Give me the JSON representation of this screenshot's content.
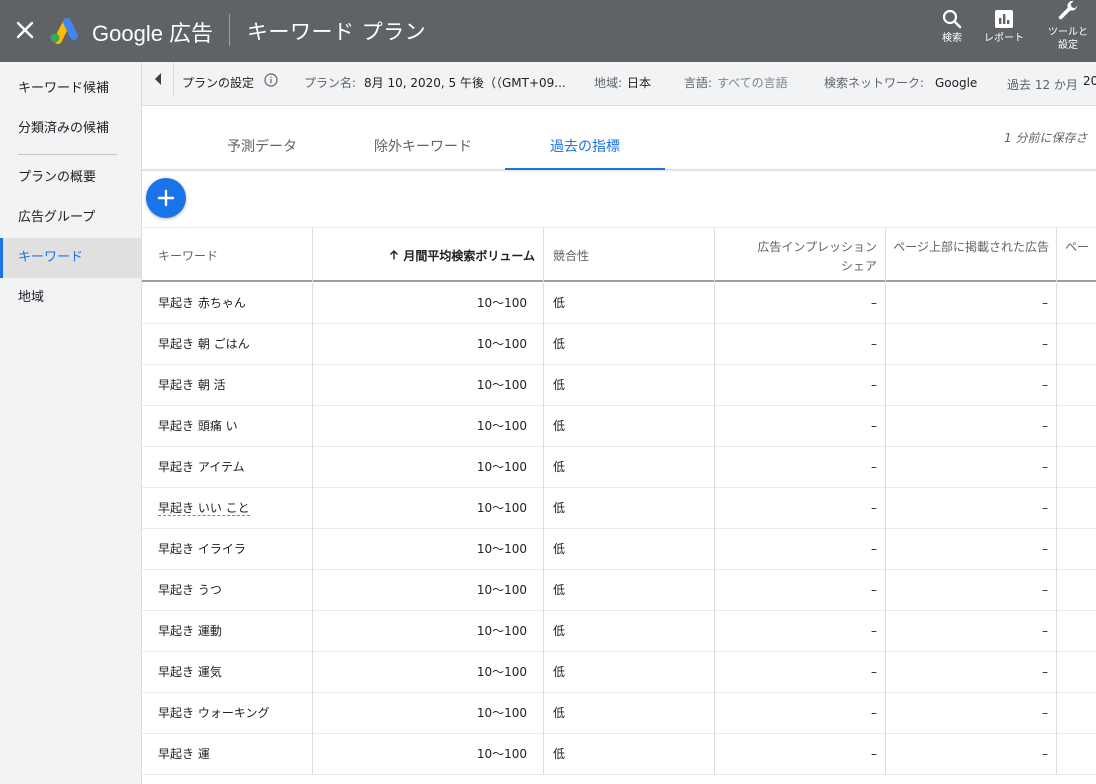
{
  "header": {
    "brand": "Google 広告",
    "page_title": "キーワード プラン",
    "actions": [
      {
        "label": "検索",
        "icon": "search-icon"
      },
      {
        "label": "レポート",
        "icon": "report-icon"
      },
      {
        "label_line1": "ツールと",
        "label_line2": "設定",
        "icon": "wrench-icon"
      }
    ]
  },
  "sidebar": {
    "items": [
      {
        "label": "キーワード候補"
      },
      {
        "label": "分類済みの候補"
      },
      {
        "label": "プランの概要"
      },
      {
        "label": "広告グループ"
      },
      {
        "label": "キーワード",
        "active": true
      },
      {
        "label": "地域"
      }
    ]
  },
  "settings": {
    "title": "プランの設定",
    "plan_name_label": "プラン名:",
    "plan_name_value": "8月 10, 2020, 5 午後（（GMT+09...",
    "region_label": "地域:",
    "region_value": "日本",
    "language_label": "言語:",
    "language_value": "すべての言語",
    "network_label": "検索ネットワーク:",
    "network_value": "Google",
    "period_label": "過去 12 か月",
    "period_value": "20"
  },
  "tabs": [
    {
      "label": "予測データ"
    },
    {
      "label": "除外キーワード"
    },
    {
      "label": "過去の指標",
      "active": true
    }
  ],
  "saved_note": "1 分前に保存さ",
  "table": {
    "columns": {
      "keyword": "キーワード",
      "volume": "月間平均検索ボリューム",
      "competition": "競合性",
      "impression_share_line1": "広告インプレッション",
      "impression_share_line2": "シェア",
      "top_of_page": "ページ上部に掲載された広告",
      "top_of_page_2": "ペー"
    },
    "rows": [
      {
        "keyword": "早起き 赤ちゃん",
        "volume": "10～100",
        "competition": "低",
        "impression_share": "–",
        "top_bid": "–"
      },
      {
        "keyword": "早起き 朝 ごはん",
        "volume": "10～100",
        "competition": "低",
        "impression_share": "–",
        "top_bid": "–"
      },
      {
        "keyword": "早起き 朝 活",
        "volume": "10～100",
        "competition": "低",
        "impression_share": "–",
        "top_bid": "–"
      },
      {
        "keyword": "早起き 頭痛 い",
        "volume": "10～100",
        "competition": "低",
        "impression_share": "–",
        "top_bid": "–"
      },
      {
        "keyword": "早起き アイテム",
        "volume": "10～100",
        "competition": "低",
        "impression_share": "–",
        "top_bid": "–"
      },
      {
        "keyword": "早起き いい こと",
        "volume": "10～100",
        "competition": "低",
        "impression_share": "–",
        "top_bid": "–"
      },
      {
        "keyword": "早起き イライラ",
        "volume": "10～100",
        "competition": "低",
        "impression_share": "–",
        "top_bid": "–"
      },
      {
        "keyword": "早起き うつ",
        "volume": "10～100",
        "competition": "低",
        "impression_share": "–",
        "top_bid": "–"
      },
      {
        "keyword": "早起き 運動",
        "volume": "10～100",
        "competition": "低",
        "impression_share": "–",
        "top_bid": "–"
      },
      {
        "keyword": "早起き 運気",
        "volume": "10～100",
        "competition": "低",
        "impression_share": "–",
        "top_bid": "–"
      },
      {
        "keyword": "早起き ウォーキング",
        "volume": "10～100",
        "competition": "低",
        "impression_share": "–",
        "top_bid": "–"
      },
      {
        "keyword": "早起き 運",
        "volume": "10～100",
        "competition": "低",
        "impression_share": "–",
        "top_bid": "–"
      }
    ]
  },
  "colors": {
    "topbar": "#5f6368",
    "accent": "#1a73e8",
    "sidebar_bg": "#f1f3f4"
  }
}
